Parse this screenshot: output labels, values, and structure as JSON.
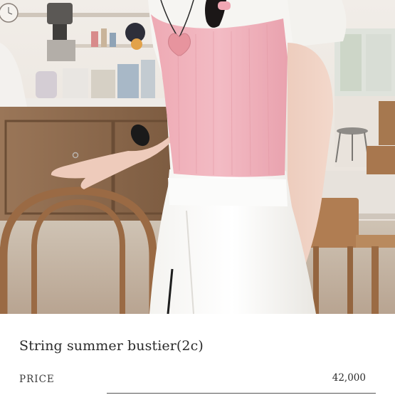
{
  "product": {
    "name": "String summer bustier(2c)",
    "price_label": "PRICE",
    "price": "42,000"
  },
  "photo": {
    "colors": {
      "wall": "#ece6df",
      "counter": "#8a6a4e",
      "top_pink": "#f1b3bd",
      "tshirt": "#f7f6f3",
      "skin": "#f1d2c4",
      "chair": "#a7764f",
      "floor": "#d9cfc3"
    }
  }
}
